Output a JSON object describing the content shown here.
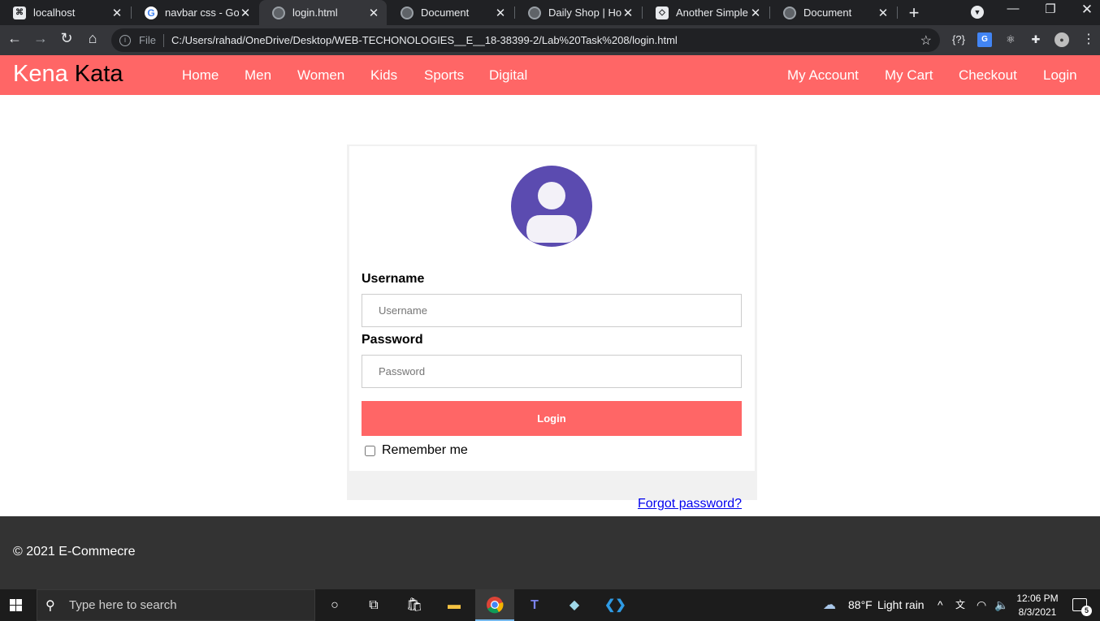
{
  "browser": {
    "tabs": [
      {
        "label": "localhost",
        "favicon": "localhost-icon"
      },
      {
        "label": "navbar css - Goog",
        "favicon": "google-icon"
      },
      {
        "label": "login.html",
        "favicon": "globe-icon"
      },
      {
        "label": "Document",
        "favicon": "globe-icon"
      },
      {
        "label": "Daily Shop | Hom",
        "favicon": "globe-icon"
      },
      {
        "label": "Another Simple F",
        "favicon": "codepen-icon"
      },
      {
        "label": "Document",
        "favicon": "globe-icon"
      }
    ],
    "active_tab_index": 2,
    "address": {
      "scheme_label": "File",
      "url": "C:/Users/rahad/OneDrive/Desktop/WEB-TECHONOLOGIES__E__18-38399-2/Lab%20Task%208/login.html"
    },
    "colors": {
      "tabstrip": "#202124",
      "toolbar": "#35363a",
      "omnibox": "#202124"
    }
  },
  "site": {
    "brand": {
      "part1": "Kena",
      "part2": "Kata"
    },
    "nav_left": [
      "Home",
      "Men",
      "Women",
      "Kids",
      "Sports",
      "Digital"
    ],
    "nav_right": [
      "My Account",
      "My Cart",
      "Checkout",
      "Login"
    ],
    "accent_color": "#ff6666"
  },
  "login": {
    "avatar_icon": "user-avatar-icon",
    "avatar_color": "#5b4bb0",
    "username_label": "Username",
    "username_placeholder": "Username",
    "password_label": "Password",
    "password_placeholder": "Password",
    "login_button": "Login",
    "remember_label": "Remember me",
    "remember_checked": false,
    "forgot_link": "Forgot password?"
  },
  "footer": {
    "copyright": "© 2021 E-Commecre",
    "background": "#333333"
  },
  "taskbar": {
    "search_placeholder": "Type here to search",
    "weather": {
      "temp": "88°F",
      "condition": "Light rain"
    },
    "clock": {
      "time": "12:06 PM",
      "date": "8/3/2021"
    },
    "notification_count": "5",
    "language_indicator": "文"
  }
}
